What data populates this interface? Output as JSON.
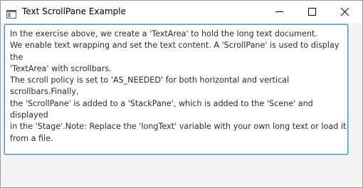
{
  "window": {
    "title": "Text ScrollPane Example",
    "accent": "#3d9ad1"
  },
  "titlebar": {
    "icons": [
      "app-window-icon",
      "minimize-icon",
      "maximize-icon",
      "close-icon"
    ]
  },
  "textarea": {
    "value": "In the exercise above, we create a 'TextArea' to hold the long text document.\nWe enable text wrapping and set the text content. A 'ScrollPane' is used to display the\n'TextArea' with scrollbars.\nThe scroll policy is set to 'AS_NEEDED' for both horizontal and vertical scrollbars.Finally,\nthe 'ScrollPane' is added to a 'StackPane', which is added to the 'Scene' and displayed\nin the 'Stage'.Note: Replace the 'longText' variable with your own long text or load it\nfrom a file."
  }
}
